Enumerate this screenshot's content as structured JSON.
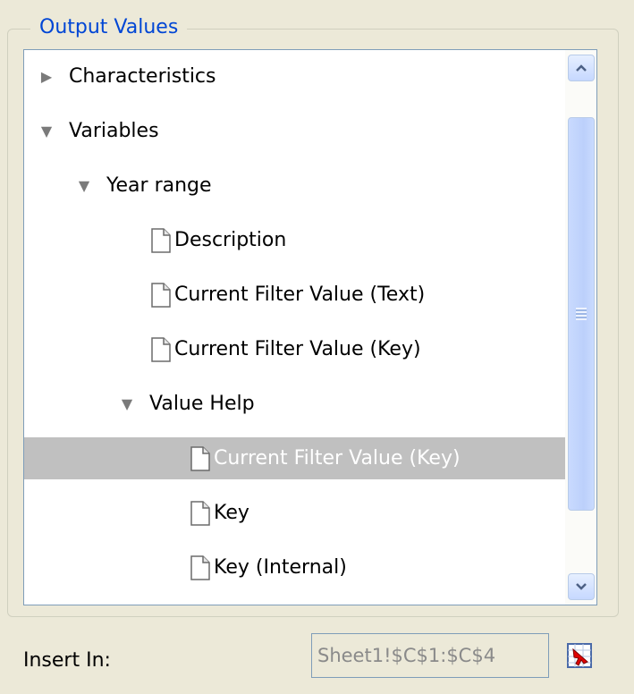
{
  "group": {
    "title": "Output Values"
  },
  "tree": {
    "nodes": [
      {
        "label": "Characteristics",
        "type": "folder",
        "state": "collapsed",
        "depth": 0
      },
      {
        "label": "Variables",
        "type": "folder",
        "state": "expanded",
        "depth": 0
      },
      {
        "label": "Year range",
        "type": "folder",
        "state": "expanded",
        "depth": 1
      },
      {
        "label": "Description",
        "type": "leaf",
        "depth": 3
      },
      {
        "label": "Current Filter Value (Text)",
        "type": "leaf",
        "depth": 3
      },
      {
        "label": "Current Filter Value (Key)",
        "type": "leaf",
        "depth": 3
      },
      {
        "label": "Value Help",
        "type": "folder",
        "state": "expanded",
        "depth": 2
      },
      {
        "label": "Current Filter Value (Key)",
        "type": "leaf",
        "depth": 4,
        "selected": true
      },
      {
        "label": "Key",
        "type": "leaf",
        "depth": 4
      },
      {
        "label": "Key (Internal)",
        "type": "leaf",
        "depth": 4
      }
    ]
  },
  "insert": {
    "label": "Insert In:",
    "value": "Sheet1!$C$1:$C$4"
  },
  "icons": {
    "collapsed": "triangle-right-icon",
    "expanded": "triangle-down-icon",
    "leaf": "document-icon",
    "scroll_up": "chevron-up-icon",
    "scroll_down": "chevron-down-icon",
    "pick": "range-select-icon"
  },
  "colors": {
    "legend": "#0046d5",
    "selection": "#c0c0c0",
    "window": "#ece9d8"
  }
}
